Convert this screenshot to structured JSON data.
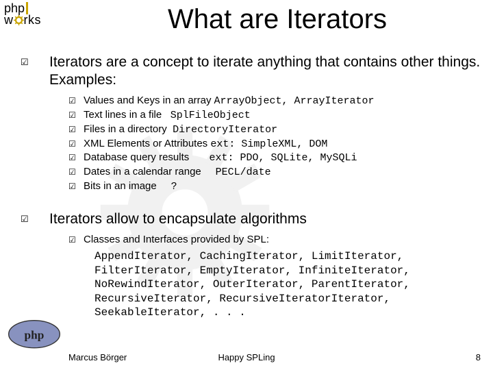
{
  "logo": {
    "line1a": "php",
    "line2a": "w",
    "line2b": "rks"
  },
  "title": "What are Iterators",
  "section1": {
    "text": "Iterators are a concept to iterate anything that contains other things. Examples:",
    "items": [
      {
        "plain": "Values and Keys in an array",
        "mono": "ArrayObject, ArrayIterator"
      },
      {
        "plain": "Text lines in a file",
        "mono": "SplFileObject"
      },
      {
        "plain": "Files in a directory",
        "mono": "DirectoryIterator"
      },
      {
        "plain": "XML Elements or Attributes",
        "mono": "ext: SimpleXML, DOM"
      },
      {
        "plain": "Database query results",
        "mono": "ext: PDO, SQLite, MySQLi"
      },
      {
        "plain": "Dates in a calendar range",
        "mono": "PECL/date"
      },
      {
        "plain": "Bits in an image",
        "mono": "?"
      }
    ]
  },
  "section2": {
    "text": "Iterators allow to encapsulate algorithms",
    "sub": "Classes and Interfaces provided by SPL:",
    "spl": "AppendIterator, CachingIterator, LimitIterator, FilterIterator, EmptyIterator, InfiniteIterator, NoRewindIterator, OuterIterator, ParentIterator, RecursiveIterator, RecursiveIteratorIterator, SeekableIterator, . . ."
  },
  "footer": {
    "left": "Marcus Börger",
    "center": "Happy SPLing",
    "right": "8"
  }
}
